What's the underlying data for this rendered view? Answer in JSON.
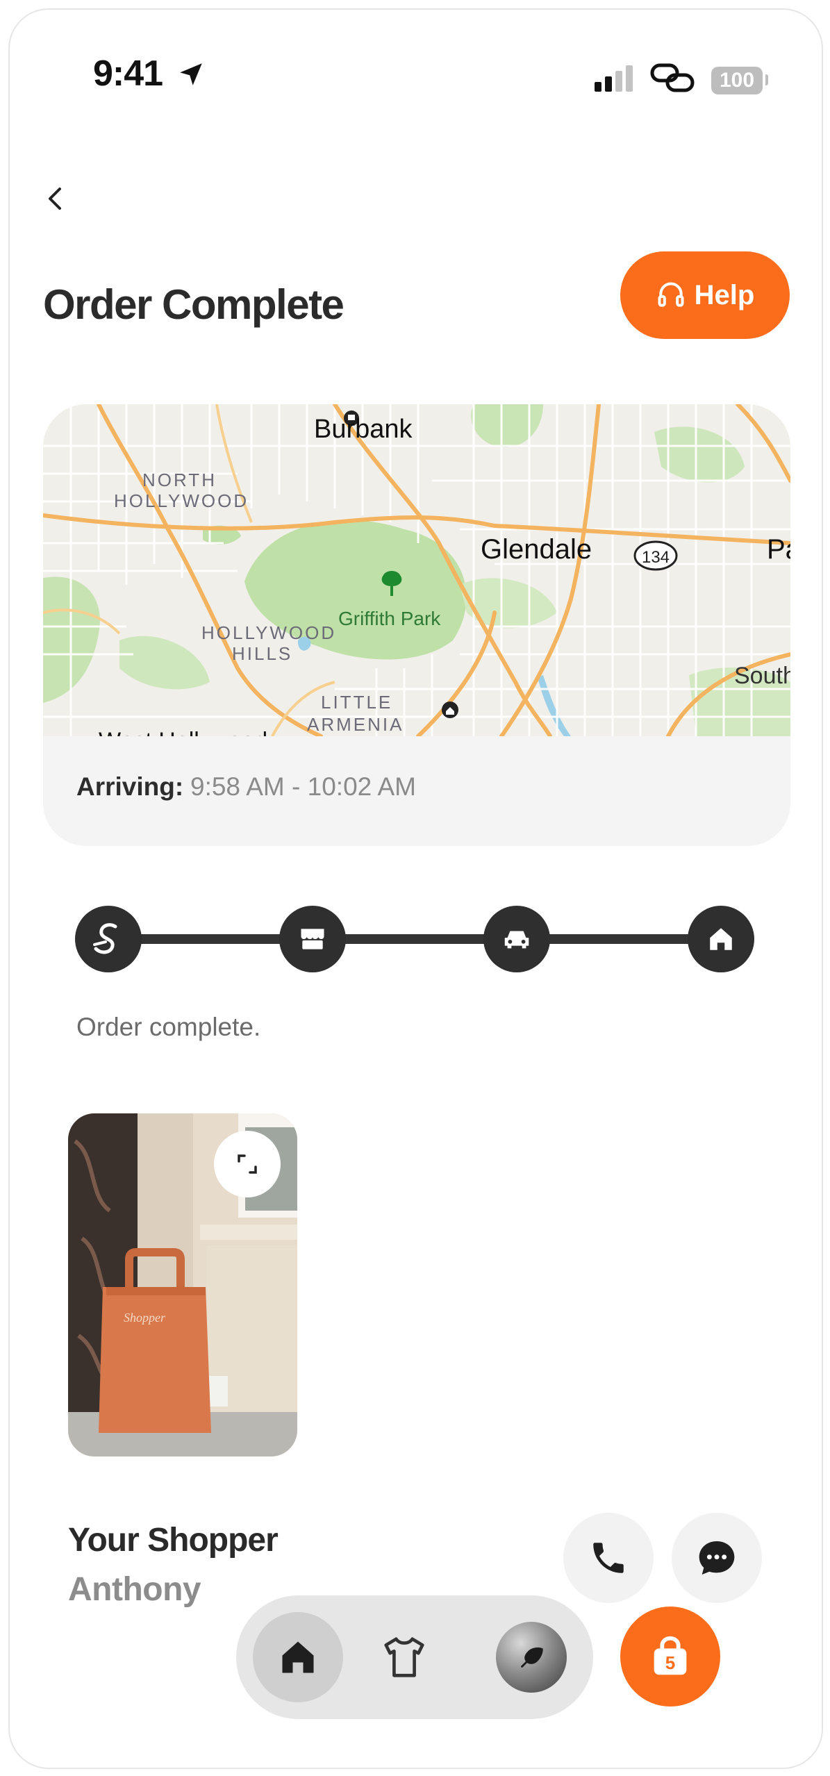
{
  "status_bar": {
    "time": "9:41",
    "battery": "100"
  },
  "header": {
    "title": "Order Complete",
    "help_label": "Help"
  },
  "map": {
    "labels": {
      "burbank": "Burbank",
      "north": "NORTH",
      "hollywood_n": "HOLLYWOOD",
      "glendale": "Glendale",
      "route": "134",
      "hollywood_hills_1": "HOLLYWOOD",
      "hollywood_hills_2": "HILLS",
      "griffith": "Griffith Park",
      "little": "LITTLE",
      "armenia": "ARMENIA",
      "south": "South",
      "pa": "Pa",
      "west_hollywood": "West Hollywood"
    },
    "arriving_label": "Arriving:",
    "arriving_value": "9:58 AM - 10:02 AM"
  },
  "tracker": {
    "steps": [
      "shopper-icon",
      "store-icon",
      "car-icon",
      "home-icon"
    ],
    "status": "Order complete."
  },
  "shopper": {
    "label": "Your Shopper",
    "name": "Anthony",
    "bag_brand": "Shopper"
  },
  "nav": {
    "cart_count": "5"
  },
  "colors": {
    "accent": "#fc6d1b",
    "dark": "#2f2f2f"
  }
}
